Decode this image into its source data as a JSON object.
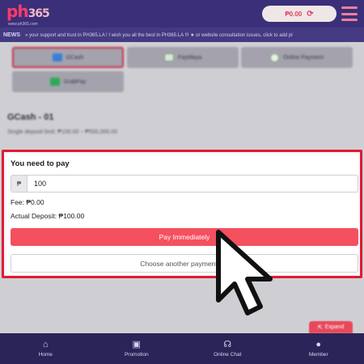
{
  "header": {
    "logo_main": "ph",
    "logo_accent": "365",
    "logo_sub": "www.ph365.com",
    "balance": "₱0.00",
    "refresh_icon": "refresh-icon",
    "menu_icon": "hamburger-menu-icon"
  },
  "news": {
    "label": "NEWS",
    "text": "» your support and trust in PH365.LA ! I wish you all the best in PH365.LA !!!  ★ or website consultation issues, click to add pl"
  },
  "payment_methods": [
    {
      "label": "GCash",
      "icon": "gcash-icon",
      "selected": true
    },
    {
      "label": "PayMaya",
      "icon": "paymaya-icon",
      "selected": false
    },
    {
      "label": "Online Payment",
      "icon": "online-payment-icon",
      "selected": false
    },
    {
      "label": "GrabPay",
      "icon": "grabpay-icon",
      "selected": false
    }
  ],
  "method_title": "GCash - 01",
  "deposit_limit": "Single deposit limit:   ₱100.00 ~ ₱500,000.00",
  "pay_card": {
    "title": "You need to pay",
    "currency": "₱",
    "amount": "100",
    "fee": "Fee: ₱0.00",
    "actual_deposit": "Actual Deposit: ₱100.00",
    "pay_button": "Pay Immediately",
    "choose_button": "Choose another payment me"
  },
  "expand": {
    "label": "Expand",
    "icon": "expand-icon"
  },
  "bottom_nav": [
    {
      "label": "Home",
      "icon": "home-icon"
    },
    {
      "label": "Promotion",
      "icon": "promotion-icon"
    },
    {
      "label": "Online Chat",
      "icon": "headset-icon"
    },
    {
      "label": "Member",
      "icon": "user-icon"
    }
  ],
  "colors": {
    "header_bg": "#3a2f78",
    "accent_red": "#e21a33",
    "pay_button": "#f4505f",
    "nav_bg": "#2b2458"
  }
}
